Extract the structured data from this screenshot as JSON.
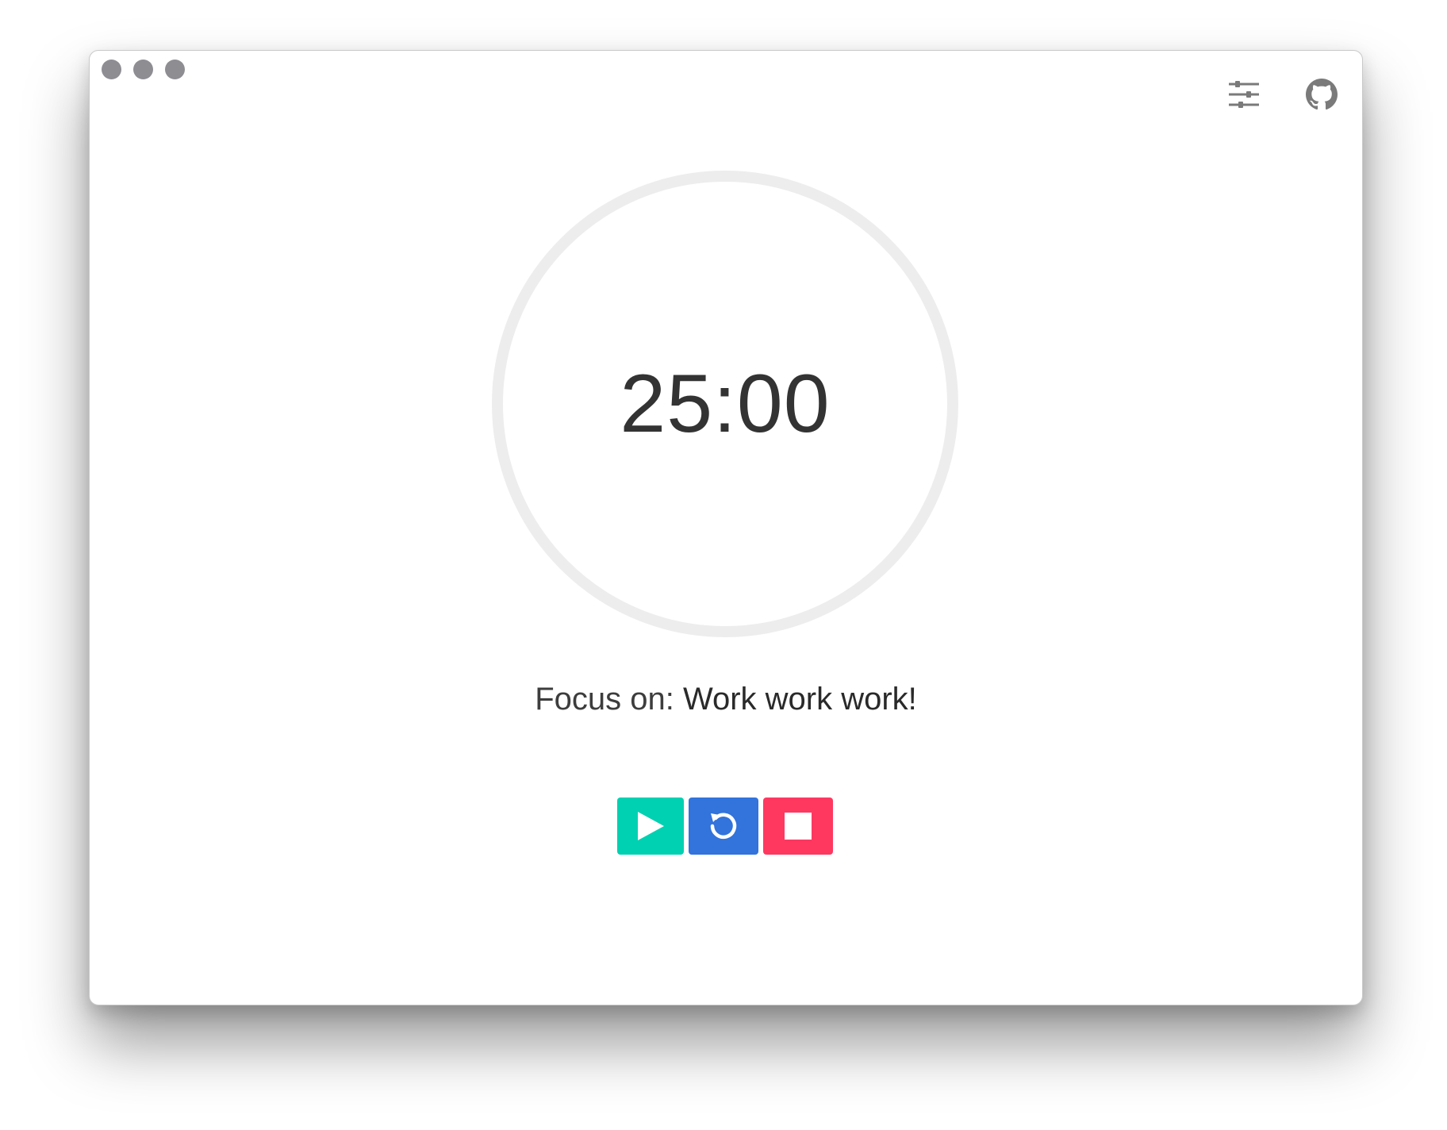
{
  "window": {
    "traffic_lights": [
      "close",
      "minimize",
      "zoom"
    ]
  },
  "toolbar": {
    "settings_icon": "sliders-icon",
    "github_icon": "github-icon"
  },
  "timer": {
    "display": "25:00",
    "progress": 0,
    "ring_color": "#ededed"
  },
  "focus": {
    "prefix": "Focus on: ",
    "task": "Work work work!"
  },
  "controls": {
    "play": {
      "icon": "play-icon",
      "color": "#00d1b2"
    },
    "reset": {
      "icon": "reset-icon",
      "color": "#3273dc"
    },
    "stop": {
      "icon": "stop-icon",
      "color": "#ff3860"
    }
  },
  "colors": {
    "text": "#333333",
    "icon_gray": "#7a7a7a",
    "dot_gray": "#8d8d92"
  }
}
